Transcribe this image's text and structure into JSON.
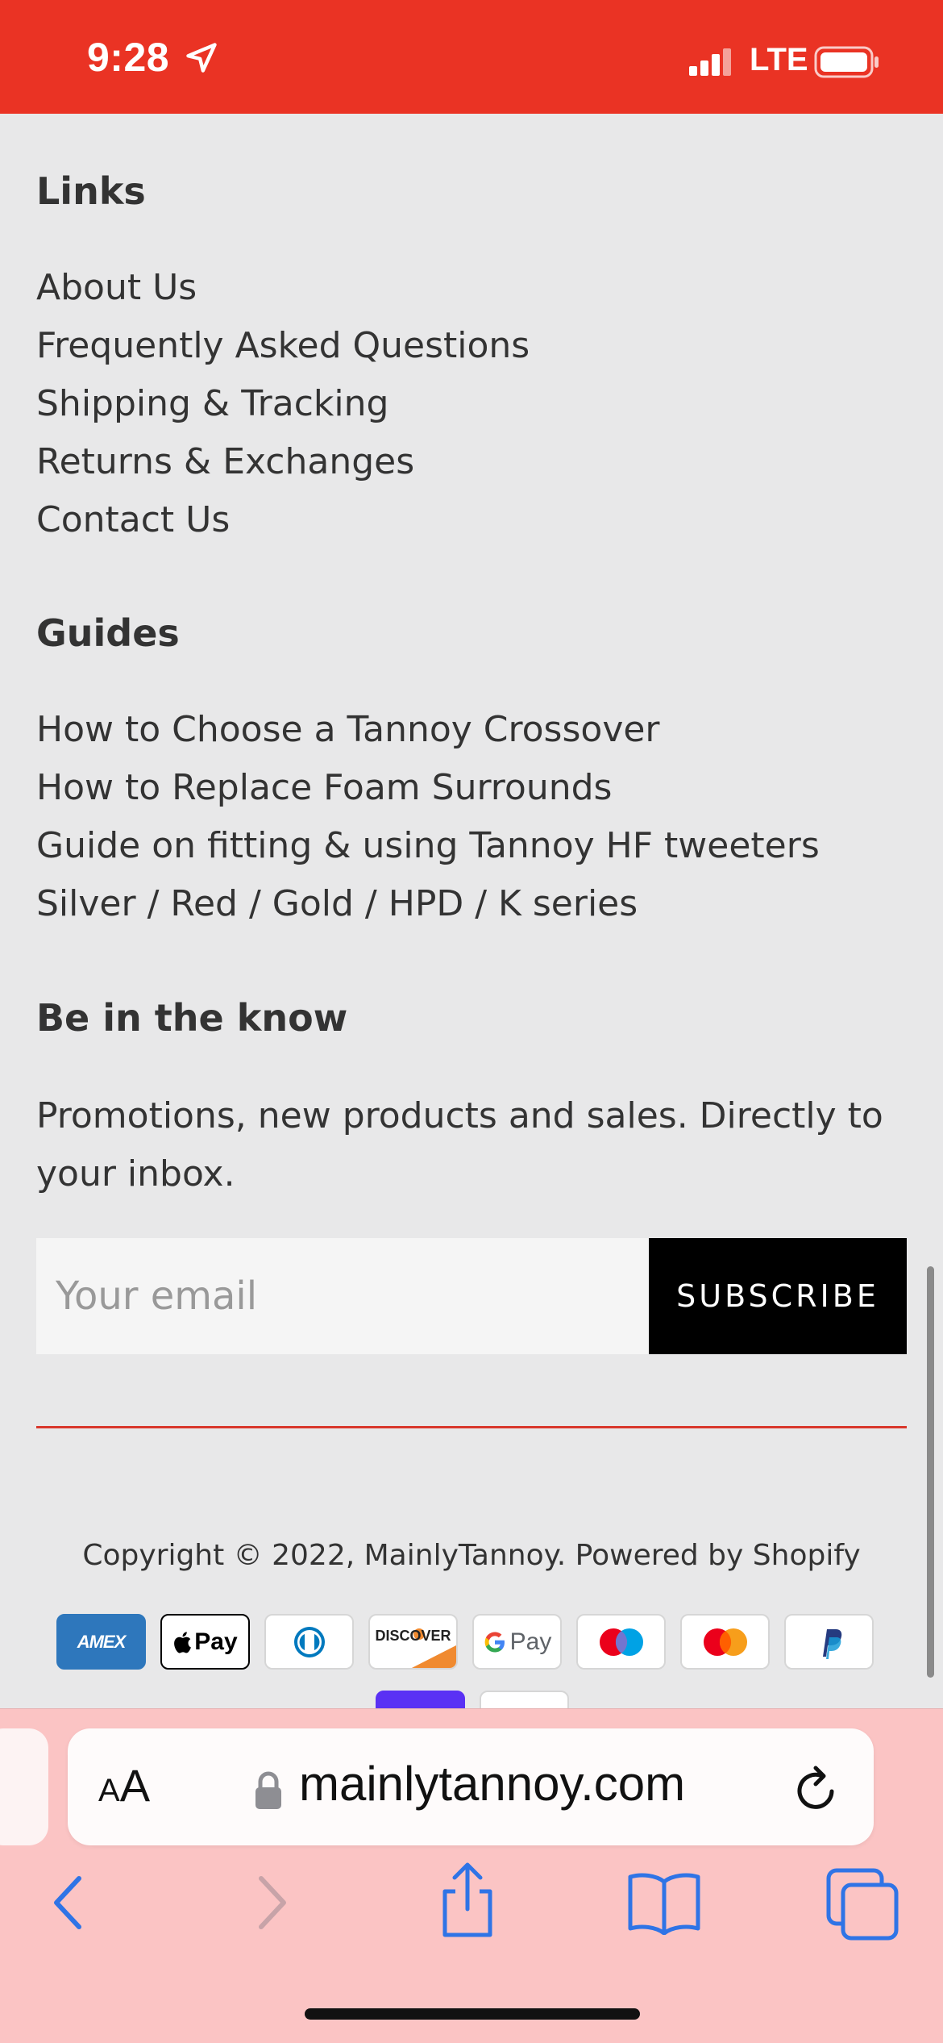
{
  "status_bar": {
    "time": "9:28",
    "network": "LTE",
    "bg_color": "#ea3324"
  },
  "links": {
    "title": "Links",
    "items": [
      "About Us",
      "Frequently Asked Questions",
      "Shipping & Tracking",
      "Returns & Exchanges",
      "Contact Us"
    ]
  },
  "guides": {
    "title": "Guides",
    "items": [
      "How to Choose a Tannoy Crossover",
      "How to Replace Foam Surrounds",
      "Guide on fitting & using Tannoy HF tweeters Silver / Red / Gold / HPD / K series"
    ]
  },
  "newsletter": {
    "title": "Be in the know",
    "text": "Promotions, new products and sales. Directly to your inbox.",
    "email_placeholder": "Your email",
    "subscribe_label": "SUBSCRIBE"
  },
  "copyright": "Copyright © 2022, MainlyTannoy. Powered by Shopify",
  "payments": {
    "amex_text": "AMEX",
    "apple_pay_text": "Pay",
    "discover_text": "DISCOVER",
    "google_pay_text": "Pay"
  },
  "browser": {
    "aa_small": "A",
    "aa_big": "A",
    "url": "mainlytannoy.com",
    "accent_color": "#2f74e6"
  }
}
